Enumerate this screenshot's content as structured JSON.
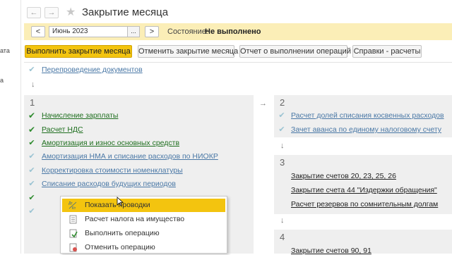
{
  "left_strip": {
    "labels": [
      "ата",
      "а"
    ]
  },
  "header": {
    "back_arrow": "←",
    "forward_arrow": "→",
    "favorite_icon": "★",
    "title": "Закрытие месяца"
  },
  "period": {
    "prev": "<",
    "value": "Июнь 2023",
    "picker": "...",
    "next": ">",
    "state_label": "Состояние:",
    "state_value": "Не выполнено"
  },
  "toolbar": {
    "run": "Выполнить закрытие месяца",
    "cancel": "Отменить закрытие месяца",
    "report": "Отчет о выполнении операций",
    "references": "Справки - расчеты"
  },
  "repost": {
    "label": "Перепроведение документов",
    "down_arrow": "↓"
  },
  "stage1": {
    "number": "1",
    "items": [
      {
        "label": "Начисление зарплаты",
        "status": "done"
      },
      {
        "label": "Расчет НДС",
        "status": "done"
      },
      {
        "label": "Амортизация и износ основных средств",
        "status": "done"
      },
      {
        "label": "Амортизация НМА и списание расходов по НИОКР",
        "status": "pending"
      },
      {
        "label": "Корректировка стоимости номенклатуры",
        "status": "pending"
      },
      {
        "label": "Списание расходов будущих периодов",
        "status": "pending"
      }
    ],
    "connector_arrow": "→"
  },
  "stage2": {
    "number": "2",
    "items": [
      {
        "label": "Расчет долей списания косвенных расходов"
      },
      {
        "label": "Зачет аванса по единому налоговому счету"
      }
    ],
    "down_arrow": "↓"
  },
  "stage3": {
    "number": "3",
    "items": [
      {
        "label": "Закрытие счетов 20, 23, 25, 26"
      },
      {
        "label": "Закрытие счета 44 \"Издержки обращения\""
      },
      {
        "label": "Расчет резервов по сомнительным долгам"
      }
    ],
    "down_arrow": "↓"
  },
  "stage4": {
    "number": "4",
    "items": [
      {
        "label": "Закрытие счетов 90, 91"
      }
    ]
  },
  "context_menu": {
    "items": [
      {
        "label": "Показать проводки",
        "icon": "dt-kt-icon",
        "highlighted": true
      },
      {
        "label": "Расчет налога на имущество",
        "icon": "document-icon",
        "highlighted": false
      },
      {
        "label": "Выполнить операцию",
        "icon": "run-document-icon",
        "highlighted": false
      },
      {
        "label": "Отменить операцию",
        "icon": "cancel-document-icon",
        "highlighted": false
      }
    ],
    "icon_glyphs": {
      "dt_kt": "Дт Кт"
    }
  },
  "colors": {
    "accent_yellow": "#f3c40f",
    "period_bg": "#fbeeb7",
    "panel_bg": "#efefef",
    "link_blue": "#4a78a6",
    "link_green": "#1e6e1e",
    "check_green": "#2e8b2e"
  }
}
